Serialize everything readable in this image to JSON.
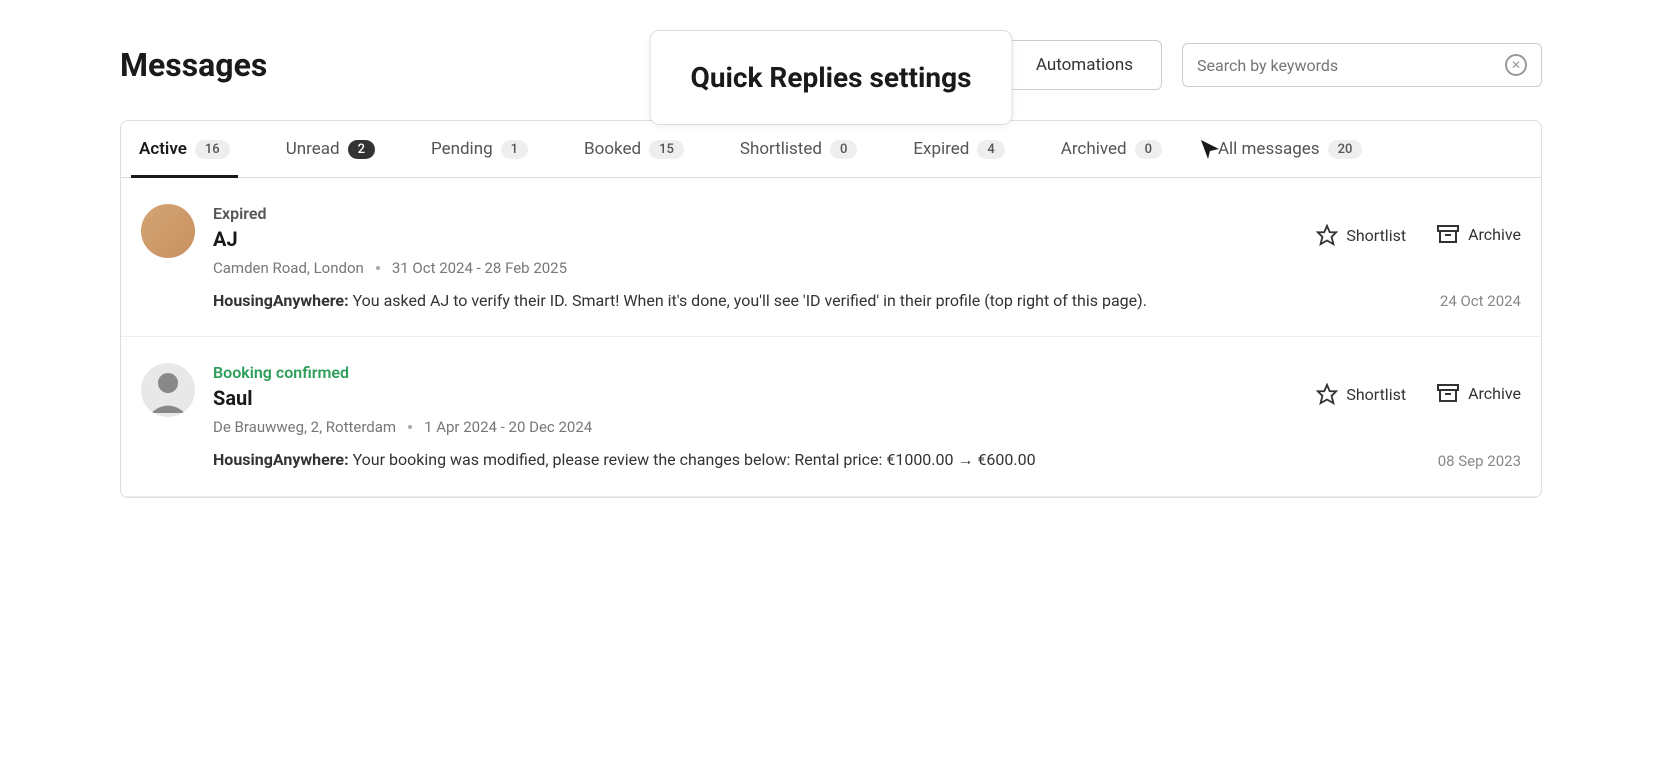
{
  "page_title": "Messages",
  "automations_label": "Automations",
  "tooltip_text": "Quick Replies settings",
  "search_placeholder": "Search by keywords",
  "tabs": [
    {
      "label": "Active",
      "count": "16",
      "active": true
    },
    {
      "label": "Unread",
      "count": "2",
      "dark": true
    },
    {
      "label": "Pending",
      "count": "1"
    },
    {
      "label": "Booked",
      "count": "15"
    },
    {
      "label": "Shortlisted",
      "count": "0"
    },
    {
      "label": "Expired",
      "count": "4"
    },
    {
      "label": "Archived",
      "count": "0"
    },
    {
      "label": "All messages",
      "count": "20"
    }
  ],
  "actions": {
    "shortlist": "Shortlist",
    "archive": "Archive"
  },
  "messages": [
    {
      "status": "Expired",
      "status_class": "expired",
      "name": "AJ",
      "location": "Camden Road, London",
      "dates": "31 Oct 2024 - 28 Feb 2025",
      "sender": "HousingAnywhere:",
      "preview": "You asked AJ to verify their ID. Smart! When it's done, you'll see 'ID verified' in their profile (top right of this page).",
      "timestamp": "24 Oct 2024",
      "avatar": "aj"
    },
    {
      "status": "Booking confirmed",
      "status_class": "confirmed",
      "name": "Saul",
      "location": "De Brauwweg, 2, Rotterdam",
      "dates": "1 Apr 2024 - 20 Dec 2024",
      "sender": "HousingAnywhere:",
      "preview": "Your booking was modified, please review the changes below: Rental price: €1000.00 → €600.00",
      "timestamp": "08 Sep 2023",
      "avatar": "saul"
    }
  ]
}
